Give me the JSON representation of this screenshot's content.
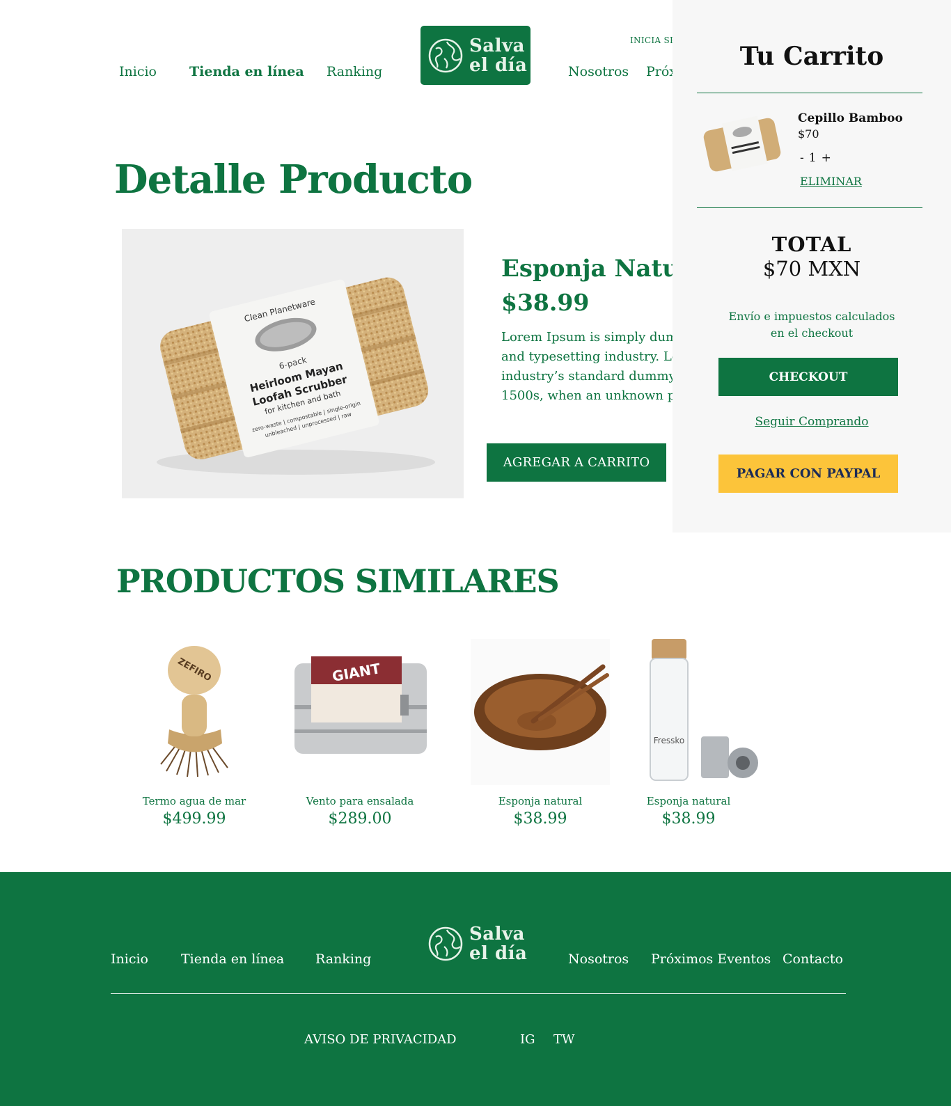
{
  "nav": {
    "inicio": "Inicio",
    "tienda": "Tienda en línea",
    "ranking": "Ranking",
    "nosotros": "Nosotros",
    "proximos_partial": "Próx",
    "login_partial": "INICIA SE"
  },
  "logo": {
    "line1": "Salva",
    "line2": "el día"
  },
  "page": {
    "title": "Detalle Producto"
  },
  "product": {
    "name": "Esponja Natural",
    "price": "$38.99",
    "description": "Lorem Ipsum is simply dummy text of the printing and typesetting industry. Lorem Ipsum has been the industry’s standard dummy text ever since the 1500s, when an unknown printer took a galley",
    "add_button": "AGREGAR A CARRITO",
    "package": {
      "brand": "Clean Planetware",
      "pack": "6-pack",
      "line1": "Heirloom Mayan",
      "line2": "Loofah Scrubber",
      "line3": "for kitchen and bath",
      "line4": "zero-waste | compostable | single-origin",
      "line5": "unbleached | unprocessed | raw"
    }
  },
  "similar": {
    "title": "PRODUCTOS SIMILARES",
    "items": [
      {
        "name": "Termo agua de mar",
        "price": "$499.99",
        "image": "brush-icon",
        "label": "ZEFIRO"
      },
      {
        "name": "Vento para ensalada",
        "price": "$289.00",
        "image": "lunchbox-icon",
        "label": "GIANT"
      },
      {
        "name": "Esponja natural",
        "price": "$38.99",
        "image": "wooden-bowl-icon"
      },
      {
        "name": "Esponja natural",
        "price": "$38.99",
        "image": "glass-bottle-icon",
        "label": "Fressko"
      }
    ]
  },
  "cart": {
    "title": "Tu Carrito",
    "item": {
      "name": "Cepillo Bamboo",
      "price": "$70",
      "minus": "-",
      "qty": "1",
      "plus": "+",
      "remove": "ELIMINAR"
    },
    "total_label": "TOTAL",
    "total_value": "$70 MXN",
    "shipping_note": "Envío e impuestos calculados en el checkout",
    "checkout": "CHECKOUT",
    "keep_shopping": "Seguir Comprando",
    "paypal": "PAGAR CON PAYPAL"
  },
  "footer": {
    "inicio": "Inicio",
    "tienda": "Tienda en línea",
    "ranking": "Ranking",
    "nosotros": "Nosotros",
    "eventos": "Próximos Eventos",
    "contacto": "Contacto",
    "privacy": "AVISO DE PRIVACIDAD",
    "ig": "IG",
    "tw": "TW"
  },
  "colors": {
    "brand_green": "#0e7441",
    "paypal_yellow": "#fcc43a",
    "cart_bg": "#f7f7f7"
  }
}
